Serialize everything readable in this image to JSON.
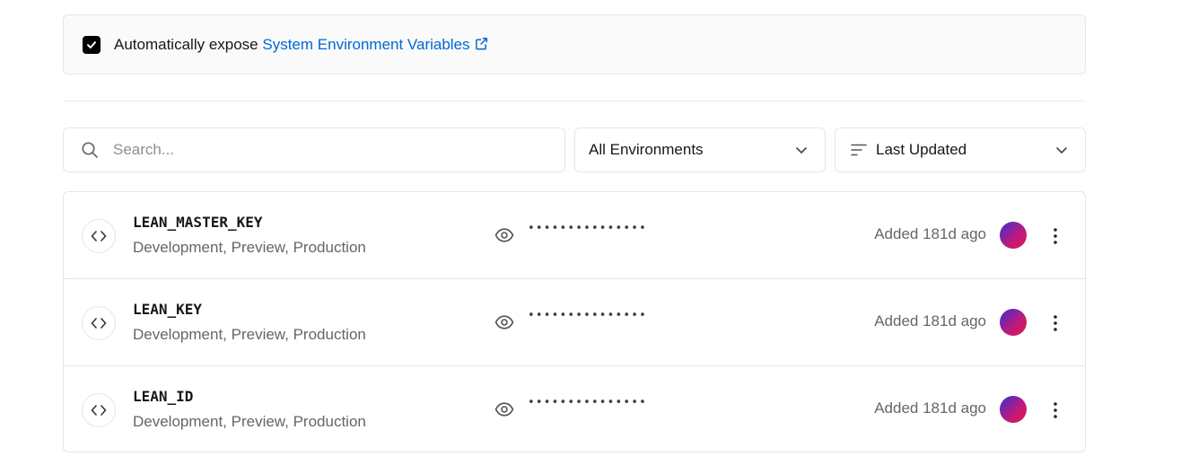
{
  "expose": {
    "checked": true,
    "prefix": "Automatically expose ",
    "link_label": "System Environment Variables"
  },
  "search": {
    "placeholder": "Search..."
  },
  "environment_filter": {
    "selected": "All Environments"
  },
  "sort": {
    "selected": "Last Updated"
  },
  "variables": [
    {
      "name": "LEAN_MASTER_KEY",
      "environments": "Development, Preview, Production",
      "value_masked": "•••••••••••••••",
      "added": "Added 181d ago"
    },
    {
      "name": "LEAN_KEY",
      "environments": "Development, Preview, Production",
      "value_masked": "•••••••••••••••",
      "added": "Added 181d ago"
    },
    {
      "name": "LEAN_ID",
      "environments": "Development, Preview, Production",
      "value_masked": "•••••••••••••••",
      "added": "Added 181d ago"
    }
  ],
  "icons": {
    "checkbox": "check-icon",
    "external": "external-link-icon",
    "search": "search-icon",
    "chevron": "chevron-down-icon",
    "sort": "sort-lines-icon",
    "code": "code-brackets-icon",
    "eye": "eye-icon",
    "more": "more-vertical-icon"
  },
  "colors": {
    "link": "#0068d6",
    "checkbox": "#000000"
  }
}
